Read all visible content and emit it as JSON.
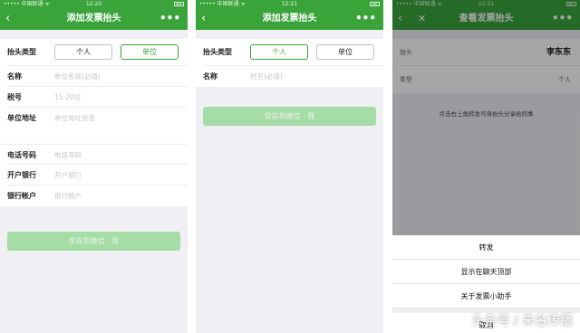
{
  "status": {
    "carrier": "••••• 中国联通 ᯤ",
    "times": [
      "12:20",
      "12:21",
      "12:21"
    ]
  },
  "screen1": {
    "nav_title": "添加发票抬头",
    "more": "•••",
    "type_label": "抬头类型",
    "type_options": [
      "个人",
      "单位"
    ],
    "fields": [
      {
        "label": "名称",
        "placeholder": "单位名称(必填)"
      },
      {
        "label": "税号",
        "placeholder": "15-20位"
      },
      {
        "label": "单位地址",
        "placeholder": "单位地址信息"
      },
      {
        "label": "电话号码",
        "placeholder": "电话号码"
      },
      {
        "label": "开户银行",
        "placeholder": "开户银行"
      },
      {
        "label": "银行帐户",
        "placeholder": "银行帐户"
      }
    ],
    "save_label": "保存到微信 · 我"
  },
  "screen2": {
    "nav_title": "添加发票抬头",
    "more": "•••",
    "type_label": "抬头类型",
    "type_options": [
      "个人",
      "单位"
    ],
    "name_label": "名称",
    "name_placeholder": "姓名(必填)",
    "save_label": "保存到微信 · 我"
  },
  "screen3": {
    "nav_title": "查看发票抬头",
    "more": "•••",
    "rows": [
      {
        "label": "抬头",
        "value": "李东东"
      },
      {
        "label": "类型",
        "value": "个人"
      }
    ],
    "hint": "点击右上角转发可将抬头分享给同事",
    "sheet_items": [
      "转发",
      "显示在聊天顶部",
      "关于发票小助手",
      "取消"
    ]
  },
  "watermark": "头条号 / 未名传播",
  "colors": {
    "accent": "#3aa43b",
    "disabled_button": "#a6dca6"
  }
}
